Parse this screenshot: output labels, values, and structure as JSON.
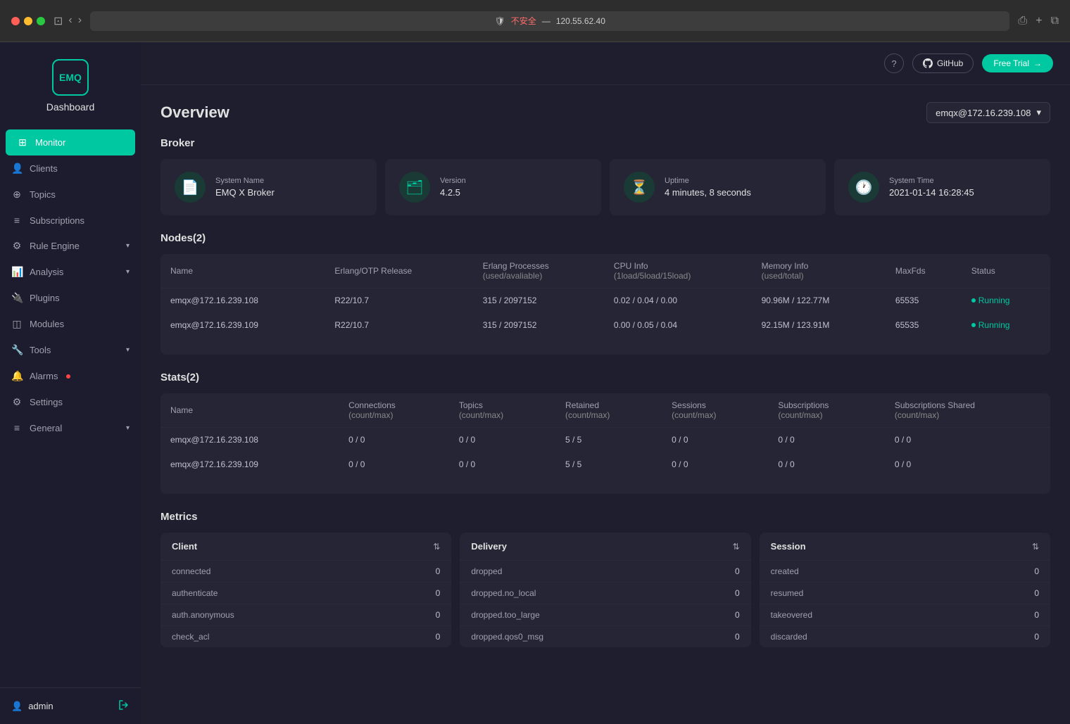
{
  "browser": {
    "address": "不安全 — 120.55.62.40",
    "address_warning": "不安全"
  },
  "header": {
    "github_label": "GitHub",
    "trial_label": "Free Trial",
    "help_label": "?",
    "node_selector": "emqx@172.16.239.108"
  },
  "sidebar": {
    "logo_text": "EMQ",
    "dashboard_label": "Dashboard",
    "items": [
      {
        "id": "monitor",
        "label": "Monitor",
        "active": true
      },
      {
        "id": "clients",
        "label": "Clients",
        "active": false
      },
      {
        "id": "topics",
        "label": "Topics",
        "active": false
      },
      {
        "id": "subscriptions",
        "label": "Subscriptions",
        "active": false
      },
      {
        "id": "rule-engine",
        "label": "Rule Engine",
        "active": false,
        "has_arrow": true
      },
      {
        "id": "analysis",
        "label": "Analysis",
        "active": false,
        "has_arrow": true
      },
      {
        "id": "plugins",
        "label": "Plugins",
        "active": false
      },
      {
        "id": "modules",
        "label": "Modules",
        "active": false
      },
      {
        "id": "tools",
        "label": "Tools",
        "active": false,
        "has_arrow": true
      },
      {
        "id": "alarms",
        "label": "Alarms",
        "active": false,
        "has_badge": true
      },
      {
        "id": "settings",
        "label": "Settings",
        "active": false
      },
      {
        "id": "general",
        "label": "General",
        "active": false,
        "has_arrow": true
      }
    ],
    "user": "admin",
    "logout_icon": "→"
  },
  "page": {
    "title": "Overview",
    "broker_section": "Broker",
    "nodes_section": "Nodes(2)",
    "stats_section": "Stats(2)",
    "metrics_section": "Metrics"
  },
  "broker_cards": [
    {
      "icon": "📄",
      "label": "System Name",
      "value": "EMQ X Broker"
    },
    {
      "icon": "🗂",
      "label": "Version",
      "value": "4.2.5"
    },
    {
      "icon": "⏳",
      "label": "Uptime",
      "value": "4 minutes, 8 seconds"
    },
    {
      "icon": "🕐",
      "label": "System Time",
      "value": "2021-01-14 16:28:45"
    }
  ],
  "nodes_table": {
    "columns": [
      "Name",
      "Erlang/OTP Release",
      "Erlang Processes\n(used/avaliable)",
      "CPU Info\n(1load/5load/15load)",
      "Memory Info\n(used/total)",
      "MaxFds",
      "Status"
    ],
    "rows": [
      {
        "name": "emqx@172.16.239.108",
        "erlang": "R22/10.7",
        "processes": "315 / 2097152",
        "cpu": "0.02 / 0.04 / 0.00",
        "memory": "90.96M / 122.77M",
        "maxfds": "65535",
        "status": "Running"
      },
      {
        "name": "emqx@172.16.239.109",
        "erlang": "R22/10.7",
        "processes": "315 / 2097152",
        "cpu": "0.00 / 0.05 / 0.04",
        "memory": "92.15M / 123.91M",
        "maxfds": "65535",
        "status": "Running"
      }
    ]
  },
  "stats_table": {
    "columns": [
      "Name",
      "Connections\n(count/max)",
      "Topics\n(count/max)",
      "Retained\n(count/max)",
      "Sessions\n(count/max)",
      "Subscriptions\n(count/max)",
      "Subscriptions Shared\n(count/max)"
    ],
    "rows": [
      {
        "name": "emqx@172.16.239.108",
        "connections": "0 / 0",
        "topics": "0 / 0",
        "retained": "5 / 5",
        "sessions": "0 / 0",
        "subscriptions": "0 / 0",
        "subscriptions_shared": "0 / 0"
      },
      {
        "name": "emqx@172.16.239.109",
        "connections": "0 / 0",
        "topics": "0 / 0",
        "retained": "5 / 5",
        "sessions": "0 / 0",
        "subscriptions": "0 / 0",
        "subscriptions_shared": "0 / 0"
      }
    ]
  },
  "metrics": {
    "client": {
      "title": "Client",
      "rows": [
        {
          "key": "connected",
          "value": "0"
        },
        {
          "key": "authenticate",
          "value": "0"
        },
        {
          "key": "auth.anonymous",
          "value": "0"
        },
        {
          "key": "check_acl",
          "value": "0"
        }
      ]
    },
    "delivery": {
      "title": "Delivery",
      "rows": [
        {
          "key": "dropped",
          "value": "0"
        },
        {
          "key": "dropped.no_local",
          "value": "0"
        },
        {
          "key": "dropped.too_large",
          "value": "0"
        },
        {
          "key": "dropped.qos0_msg",
          "value": "0"
        }
      ]
    },
    "session": {
      "title": "Session",
      "rows": [
        {
          "key": "created",
          "value": "0"
        },
        {
          "key": "resumed",
          "value": "0"
        },
        {
          "key": "takeovered",
          "value": "0"
        },
        {
          "key": "discarded",
          "value": "0"
        }
      ]
    }
  }
}
